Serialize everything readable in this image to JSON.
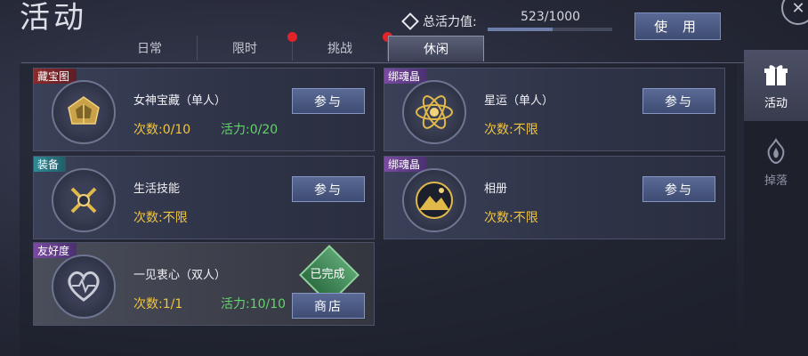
{
  "header": {
    "title": "活动",
    "vitality_label": "总活力值:",
    "vitality_value": "523/1000",
    "vitality_fraction": 0.523,
    "use_button": "使 用"
  },
  "tabs": [
    {
      "label": "日常",
      "active": false,
      "red_dot": false
    },
    {
      "label": "限时",
      "active": false,
      "red_dot": true
    },
    {
      "label": "挑战",
      "active": false,
      "red_dot": true
    },
    {
      "label": "休闲",
      "active": true,
      "red_dot": false
    }
  ],
  "activities": [
    {
      "tag": "藏宝图",
      "tag_color": "red",
      "icon": "treasure-chest-icon",
      "name": "女神宝藏（单人）",
      "count": "次数:0/10",
      "vitality": "活力:0/20",
      "button": "参与"
    },
    {
      "tag": "绑魂晶",
      "tag_color": "purple",
      "icon": "atom-star-icon",
      "name": "星运（单人）",
      "count": "次数:不限",
      "vitality": "",
      "button": "参与"
    },
    {
      "tag": "装备",
      "tag_color": "teal",
      "icon": "crossed-tools-icon",
      "name": "生活技能",
      "count": "次数:不限",
      "vitality": "",
      "button": "参与"
    },
    {
      "tag": "绑魂晶",
      "tag_color": "purple",
      "icon": "mountain-photo-icon",
      "name": "相册",
      "count": "次数:不限",
      "vitality": "",
      "button": "参与"
    },
    {
      "tag": "友好度",
      "tag_color": "purple",
      "icon": "heart-icon",
      "name": "一见衷心（双人）",
      "count": "次数:1/1",
      "vitality": "活力:10/10",
      "done_label": "已完成",
      "button": "商店"
    }
  ],
  "side_nav": [
    {
      "label": "活动",
      "icon": "gift-icon",
      "active": true
    },
    {
      "label": "掉落",
      "icon": "flame-emblem-icon",
      "active": false
    }
  ],
  "colors": {
    "count": "#f2c53a",
    "vitality": "#63d46a",
    "button": "#4a5a85",
    "done": "#3f8a58"
  }
}
